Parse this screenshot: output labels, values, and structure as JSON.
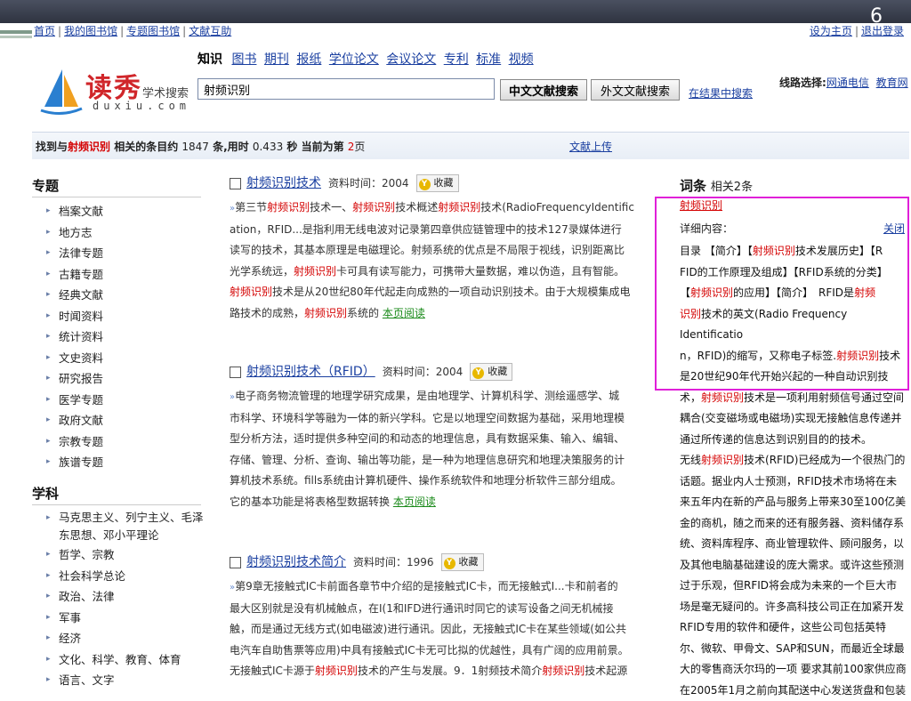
{
  "slide": {
    "page_number": "6"
  },
  "topnav": {
    "items": [
      "首页",
      "我的图书馆",
      "专题图书馆",
      "文献互助"
    ],
    "right": [
      "设为主页",
      "退出登录"
    ]
  },
  "logo": {
    "brand": "读秀",
    "tagline": "学术搜索",
    "latin": "duxiu.com"
  },
  "categories": {
    "lead": "知识",
    "items": [
      "图书",
      "期刊",
      "报纸",
      "学位论文",
      "会议论文",
      "专利",
      "标准",
      "视频"
    ]
  },
  "search": {
    "value": "射频识别",
    "btn_chinese": "中文文献搜索",
    "btn_foreign": "外文文献搜索",
    "in_results": "在结果中搜索"
  },
  "line_select": {
    "label": "线路选择:",
    "options": [
      "网通电信",
      "教育网"
    ]
  },
  "result_bar": {
    "pre": "找到与",
    "term": "射频识别",
    "mid": " 相关的条目约 ",
    "count": "1847",
    "count_unit": " 条,用时 ",
    "time": "0.433",
    "time_unit": " 秒  当前为第 ",
    "page": "2",
    "page_unit": "页",
    "upload": "文献上传"
  },
  "sidebar": {
    "topics_head": "专题",
    "topics": [
      "档案文献",
      "地方志",
      "法律专题",
      "古籍专题",
      "经典文献",
      "时闻资料",
      "统计资料",
      "文史资料",
      "研究报告",
      "医学专题",
      "政府文献",
      "宗教专题",
      "族谱专题"
    ],
    "subjects_head": "学科",
    "subjects": [
      "马克思主义、列宁主义、毛泽东思想、邓小平理论",
      "哲学、宗教",
      "社会科学总论",
      "政治、法律",
      "军事",
      "经济",
      "文化、科学、教育、体育",
      "语言、文字"
    ]
  },
  "results": [
    {
      "title": "射频识别技术",
      "meta": "资料时间：2004",
      "fav": "收藏",
      "snippet": [
        [
          [
            "»",
            "arr"
          ],
          [
            "第三节",
            ""
          ],
          [
            "射频识别",
            "red"
          ],
          [
            "技术一、",
            ""
          ],
          [
            "射频识别",
            "red"
          ],
          [
            "技术概述",
            ""
          ],
          [
            "射频识别",
            "red"
          ],
          [
            "技术(RadioFrequencyIdentific",
            ""
          ]
        ],
        [
          [
            "ation，RFID...是指利用无线电波对记录第四章供应链管理中的技术127录媒体进行",
            ""
          ]
        ],
        [
          [
            "读写的技术，其基本原理是电磁理论。射频系统的优点是不局限于视线，识别距离比",
            ""
          ]
        ],
        [
          [
            "光学系统远，",
            ""
          ],
          [
            "射频识别",
            "red"
          ],
          [
            "卡可具有读写能力，可携带大量数据，难以伪造，且有智能。",
            ""
          ]
        ],
        [
          [
            "射频识别",
            "red"
          ],
          [
            "技术是从20世纪80年代起走向成熟的一项自动识别技术。由于大规模集成电",
            ""
          ]
        ],
        [
          [
            "路技术的成熟，",
            ""
          ],
          [
            "射频识别",
            "red"
          ],
          [
            "系统的 ",
            ""
          ],
          [
            "本页阅读",
            "read"
          ]
        ]
      ]
    },
    {
      "title": "射频识别技术（RFID）",
      "meta": "资料时间：2004",
      "fav": "收藏",
      "snippet": [
        [
          [
            "»",
            "arr"
          ],
          [
            "电子商务物流管理的地理学研究成果，是由地理学、计算机科学、测绘遥感学、城",
            ""
          ]
        ],
        [
          [
            "市科学、环境科学等融为一体的新兴学科。它是以地理空间数据为基础，采用地理模",
            ""
          ]
        ],
        [
          [
            "型分析方法，适时提供多种空间的和动态的地理信息，具有数据采集、输入、编辑、",
            ""
          ]
        ],
        [
          [
            "存储、管理、分析、查询、输出等功能，是一种为地理信息研究和地理决策服务的计",
            ""
          ]
        ],
        [
          [
            "算机技术系统。fills系统由计算机硬件、操作系统软件和地理分析软件三部分组成。",
            ""
          ]
        ],
        [
          [
            "它的基本功能是将表格型数据转换 ",
            ""
          ],
          [
            "本页阅读",
            "read"
          ]
        ]
      ]
    },
    {
      "title": "射频识别技术简介",
      "meta": "资料时间：1996",
      "fav": "收藏",
      "snippet": [
        [
          [
            "»",
            "arr"
          ],
          [
            "第9章无接触式IC卡前面各章节中介绍的是接触式IC卡，而无接触式I...卡和前者的",
            ""
          ]
        ],
        [
          [
            "最大区别就是没有机械触点，在I(1和IFD进行通讯时同它的读写设备之间无机械接",
            ""
          ]
        ],
        [
          [
            "触，而是通过无线方式(如电磁波)进行通讯。因此，无接触式IC卡在某些领域(如公共",
            ""
          ]
        ],
        [
          [
            "电汽车自助售票等应用)中具有接触式IC卡无可比拟的优越性，具有广阔的应用前景。",
            ""
          ]
        ],
        [
          [
            "无接触式IC卡源于",
            ""
          ],
          [
            "射频识别",
            "red"
          ],
          [
            "技术的产生与发展。9．1射频技术简介",
            ""
          ],
          [
            "射频识别",
            "red"
          ],
          [
            "技术起源",
            ""
          ]
        ]
      ]
    }
  ],
  "right_panel": {
    "head": "词条",
    "head_sub": "相关2条",
    "term": "射频识别",
    "detail_label": "详细内容：",
    "close": "关闭",
    "lines": [
      [
        [
          "目录 【简介】【",
          ""
        ],
        [
          "射频识别",
          "red"
        ],
        [
          "技术发展历史】【R",
          ""
        ]
      ],
      [
        [
          "FID的工作原理及组成】【RFID系统的分类】",
          ""
        ]
      ],
      [
        [
          "【",
          ""
        ],
        [
          "射频识别",
          "red"
        ],
        [
          "的应用】【简介】　RFID是",
          ""
        ],
        [
          "射频",
          "red"
        ]
      ],
      [
        [
          "识别",
          "red"
        ],
        [
          "技术的英文(Radio Frequency Identificatio",
          ""
        ]
      ],
      [
        [
          "n，RFID)的缩写，又称电子标签.",
          ""
        ],
        [
          "射频识别",
          "red"
        ],
        [
          "技术",
          ""
        ]
      ],
      [
        [
          "是20世纪90年代开始兴起的一种自动识别技",
          ""
        ]
      ],
      [
        [
          "术，",
          ""
        ],
        [
          "射频识别",
          "red"
        ],
        [
          "技术是一项利用射频信号通过空间",
          ""
        ]
      ],
      [
        [
          "耦合(交变磁场或电磁场)实现无接触信息传递并",
          ""
        ]
      ],
      [
        [
          "通过所传递的信息达到识别目的的技术。",
          ""
        ]
      ],
      [
        [
          "无线",
          ""
        ],
        [
          "射频识别",
          "red"
        ],
        [
          "技术(RFID)已经成为一个很热门的",
          ""
        ]
      ],
      [
        [
          "话题。据业内人士预测，RFID技术市场将在未",
          ""
        ]
      ],
      [
        [
          "来五年内在新的产品与服务上带来30至100亿美",
          ""
        ]
      ],
      [
        [
          "金的商机，随之而来的还有服务器、资料储存系",
          ""
        ]
      ],
      [
        [
          "统、资料库程序、商业管理软件、顾问服务，以",
          ""
        ]
      ],
      [
        [
          "及其他电脑基础建设的庞大需求。或许这些预测",
          ""
        ]
      ],
      [
        [
          "过于乐观，但RFID将会成为未来的一个巨大市",
          ""
        ]
      ],
      [
        [
          "场是毫无疑问的。许多高科技公司正在加紧开发",
          ""
        ]
      ],
      [
        [
          "RFID专用的软件和硬件，这些公司包括英特",
          ""
        ]
      ],
      [
        [
          "尔、微软、甲骨文、SAP和SUN，而最近全球最",
          ""
        ]
      ],
      [
        [
          "大的零售商沃尔玛的一项 要求其前100家供应商",
          ""
        ]
      ],
      [
        [
          "在2005年1月之前向其配送中心发送货盘和包装",
          ""
        ]
      ]
    ]
  },
  "colors": {
    "accent_red": "#d40000",
    "link_blue": "#1a3fa0",
    "highlight_magenta": "#e020d8",
    "read_green": "#1a8a1a"
  }
}
